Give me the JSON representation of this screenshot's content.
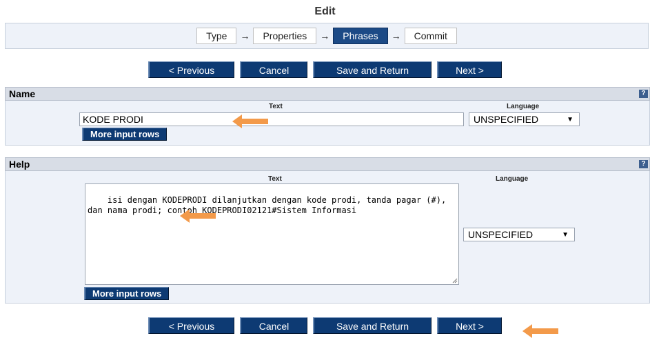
{
  "page": {
    "title": "Edit"
  },
  "wizard": {
    "stages": [
      {
        "label": "Type",
        "current": false
      },
      {
        "label": "Properties",
        "current": false
      },
      {
        "label": "Phrases",
        "current": true
      },
      {
        "label": "Commit",
        "current": false
      }
    ],
    "arrow_glyph": "→"
  },
  "nav": {
    "previous": "< Previous",
    "cancel": "Cancel",
    "save_return": "Save and Return",
    "next": "Next >"
  },
  "name_section": {
    "title": "Name",
    "help_icon": "?",
    "text_header": "Text",
    "language_header": "Language",
    "text_value": "KODE PRODI",
    "language_value": "UNSPECIFIED",
    "more_rows": "More input rows"
  },
  "help_section": {
    "title": "Help",
    "help_icon": "?",
    "text_header": "Text",
    "language_header": "Language",
    "text_value": "isi dengan KODEPRODI dilanjutkan dengan kode prodi, tanda pagar (#), dan nama prodi; contoh KODEPRODI02121#Sistem Informasi",
    "language_value": "UNSPECIFIED",
    "more_rows": "More input rows"
  },
  "colors": {
    "button": "#0d3a73",
    "panel": "#eef2f9",
    "header": "#d8dde6",
    "arrow_annotation": "#f39a4a"
  },
  "icons": [
    "help-icon",
    "chevron-down-icon",
    "right-arrow-icon",
    "orange-arrow-annotation"
  ]
}
